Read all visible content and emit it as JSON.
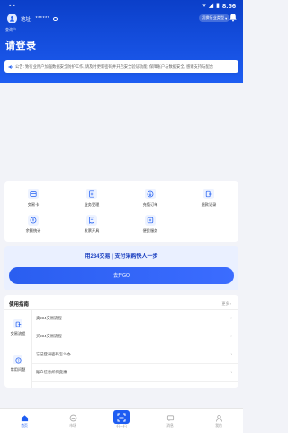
{
  "statusbar": {
    "time": "8:56"
  },
  "header": {
    "account_label": "地址:",
    "account_mask": "******",
    "switch_label": "切换行业类型",
    "sub_label": "查询户",
    "title": "请登录"
  },
  "notice": {
    "text": "公告: 致行业用户加强数据安全防护工作, 请及时更新密码并开启安全验证功能, 保障账户与数据安全, 感谢支持与配合"
  },
  "grid": {
    "items": [
      {
        "label": "交易卡",
        "icon": "card-icon"
      },
      {
        "label": "业务受理",
        "icon": "document-icon"
      },
      {
        "label": "充值订单",
        "icon": "recharge-icon"
      },
      {
        "label": "退款记录",
        "icon": "exit-icon"
      },
      {
        "label": "余额统计",
        "icon": "coin-icon"
      },
      {
        "label": "发票开具",
        "icon": "invoice-icon"
      },
      {
        "label": "便民服务",
        "icon": "service-icon"
      }
    ]
  },
  "promo": {
    "headline": "用234交易 | 支付采购快人一步",
    "button": "去开GO"
  },
  "guide": {
    "title": "使用指南",
    "more": "更多",
    "categories": [
      {
        "label": "交易流程",
        "icon": "flow-icon",
        "items": [
          "卖234交易流程",
          "买234交易流程"
        ]
      },
      {
        "label": "常用问题",
        "icon": "question-icon",
        "items": [
          "忘记登录密码怎么办",
          "账户信息如何变更"
        ]
      }
    ]
  },
  "tabbar": {
    "tabs": [
      {
        "label": "首页",
        "icon": "home-icon",
        "active": true
      },
      {
        "label": "市场",
        "icon": "market-icon",
        "active": false
      },
      {
        "label": "扫一扫",
        "icon": "scan-icon",
        "active": false
      },
      {
        "label": "消息",
        "icon": "message-icon",
        "active": false
      },
      {
        "label": "我的",
        "icon": "user-icon",
        "active": false
      }
    ]
  },
  "colors": {
    "brand": "#1e5df2",
    "header_dark": "#0b3fc9"
  }
}
